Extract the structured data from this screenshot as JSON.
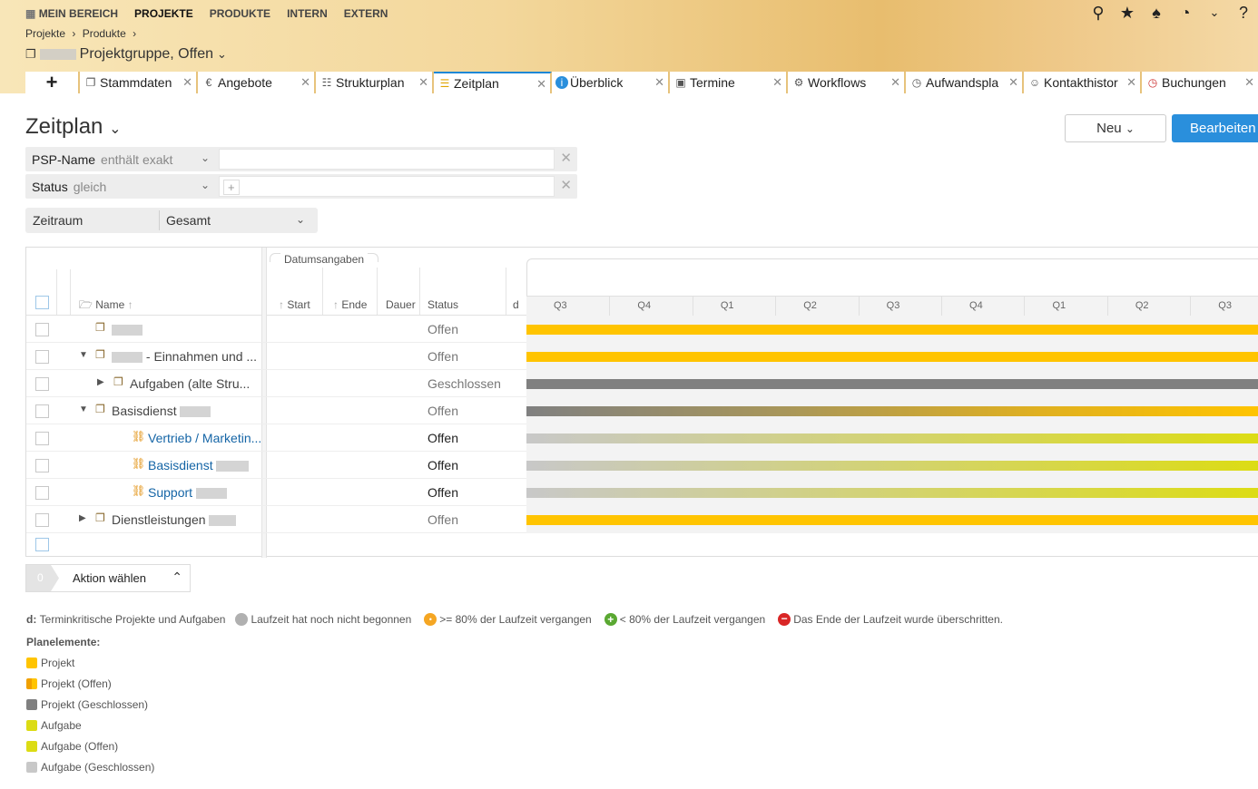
{
  "topnav": {
    "items": [
      "MEIN BEREICH",
      "PROJEKTE",
      "PRODUKTE",
      "INTERN",
      "EXTERN"
    ],
    "active_index": 1
  },
  "icons": {
    "search": "search-icon",
    "star": "star-icon",
    "bell": "bell-icon",
    "timer": "timer-icon",
    "help": "help-icon"
  },
  "breadcrumb": {
    "items": [
      "Projekte",
      "›",
      "Produkte",
      "›"
    ]
  },
  "project": {
    "title": "Projektgruppe, Offen"
  },
  "tabs": [
    {
      "label": "Stammdaten",
      "icon": "folder-icon"
    },
    {
      "label": "Angebote",
      "icon": "offer-icon"
    },
    {
      "label": "Strukturplan",
      "icon": "structure-icon"
    },
    {
      "label": "Zeitplan",
      "icon": "schedule-icon"
    },
    {
      "label": "Überblick",
      "icon": "info-icon"
    },
    {
      "label": "Termine",
      "icon": "calendar-icon"
    },
    {
      "label": "Workflows",
      "icon": "workflow-icon"
    },
    {
      "label": "Aufwandspla",
      "icon": "effort-icon"
    },
    {
      "label": "Kontakthistor",
      "icon": "contacts-icon"
    },
    {
      "label": "Buchungen",
      "icon": "booking-icon"
    }
  ],
  "page": {
    "title": "Zeitplan",
    "new_button": "Neu",
    "edit_button": "Bearbeiten"
  },
  "filters": [
    {
      "label": "PSP-Name",
      "operator": "enthält exakt",
      "value": ""
    },
    {
      "label": "Status",
      "operator": "gleich",
      "value": "+"
    }
  ],
  "zeitraum": {
    "label": "Zeitraum",
    "value": "Gesamt"
  },
  "grid": {
    "group_header": "Datumsangaben",
    "columns": {
      "name": "Name",
      "start": "Start",
      "end": "Ende",
      "duration": "Dauer",
      "status": "Status",
      "d": "d"
    },
    "quarters": [
      "Q3",
      "Q4",
      "Q1",
      "Q2",
      "Q3",
      "Q4",
      "Q1",
      "Q2",
      "Q3"
    ],
    "rows": [
      {
        "name": "",
        "status": "Offen"
      },
      {
        "name": "- Einnahmen und ...",
        "status": "Offen"
      },
      {
        "name": "Aufgaben (alte Stru...",
        "status": "Geschlossen"
      },
      {
        "name": "Basisdienst",
        "status": "Offen"
      },
      {
        "name": "Vertrieb / Marketin...",
        "status": "Offen"
      },
      {
        "name": "Basisdienst",
        "status": "Offen"
      },
      {
        "name": "Support",
        "status": "Offen"
      },
      {
        "name": "Dienstleistungen",
        "status": "Offen"
      }
    ]
  },
  "action": {
    "count": "0",
    "label": "Aktion wählen"
  },
  "legend": {
    "d_label": "d:",
    "d_text": "Terminkritische Projekte und Aufgaben",
    "items": [
      "Laufzeit hat noch nicht begonnen",
      ">= 80% der Laufzeit vergangen",
      "< 80% der Laufzeit vergangen",
      "Das Ende der Laufzeit wurde überschritten."
    ],
    "plan_title": "Planelemente:",
    "plan_items": [
      "Projekt",
      "Projekt (Offen)",
      "Projekt (Geschlossen)",
      "Aufgabe",
      "Aufgabe (Offen)",
      "Aufgabe (Geschlossen)"
    ]
  },
  "colors": {
    "project": "#ffc400",
    "closed": "#808080",
    "task": "#dcdc14",
    "task_closed": "#c8c8c8",
    "accent": "#2a8fdc"
  }
}
